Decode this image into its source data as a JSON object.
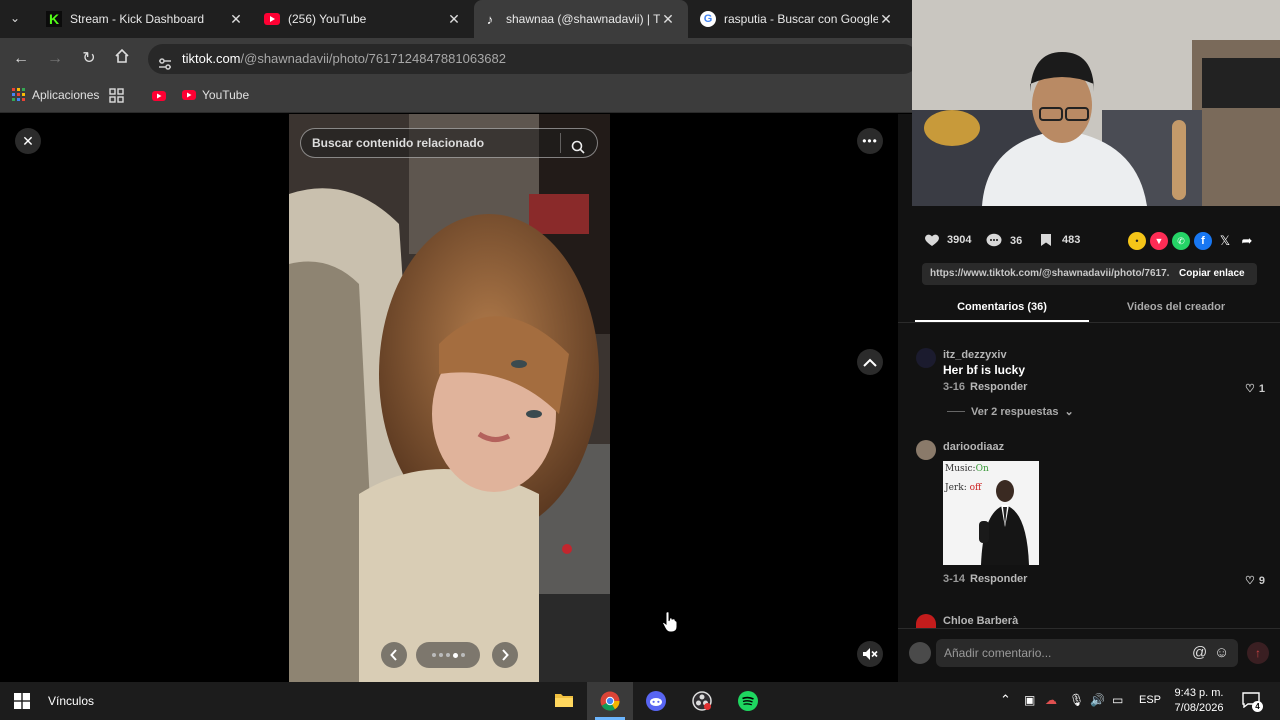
{
  "tabs": [
    {
      "title": "Stream - Kick Dashboard",
      "icon": "kick-icon",
      "color": "#53fc18"
    },
    {
      "title": "(256) YouTube",
      "icon": "youtube-icon",
      "color": "#ff0033"
    },
    {
      "title": "shawnaa (@shawnadavii) | TikT",
      "icon": "tiktok-icon",
      "color": "#ffffff"
    },
    {
      "title": "rasputia - Buscar con Google",
      "icon": "google-icon",
      "color": "#4285f4"
    }
  ],
  "address": {
    "host": "tiktok.com",
    "path": "/@shawnadavii/photo/7617124847881063682"
  },
  "bookmarks": {
    "apps": "Aplicaciones",
    "youtube": "YouTube"
  },
  "viewer": {
    "search_placeholder": "Buscar contenido relacionado",
    "slides_total": 5,
    "slide_current": 4
  },
  "actions": {
    "likes": "3904",
    "comments": "36",
    "saves": "483"
  },
  "share": {
    "url": "https://www.tiktok.com/@shawnadavii/photo/7617...",
    "copy_label": "Copiar enlace",
    "colors": [
      "#f5c518",
      "#fe2c55",
      "#25d366",
      "#1877f2"
    ]
  },
  "panel_tabs": {
    "comments": "Comentarios (36)",
    "creator_videos": "Videos del creador"
  },
  "comments": [
    {
      "user": "itz_dezzyxiv",
      "text": "Her bf is lucky",
      "date": "3-16",
      "reply": "Responder",
      "likes": "1",
      "replies": "Ver 2 respuestas"
    },
    {
      "user": "darioodiaaz",
      "date": "3-14",
      "reply": "Responder",
      "likes": "9",
      "image": {
        "line1a": "Music:",
        "line1b": "On",
        "line2a": "Jerk:",
        "line2b": "off"
      }
    },
    {
      "user": "Chloe Barberà"
    }
  ],
  "comment_input": {
    "placeholder": "Añadir comentario..."
  },
  "taskbar": {
    "links": "Vínculos",
    "lang": "ESP",
    "time": "9:43 p. m.",
    "date": "7/08/2026",
    "notifications": "4"
  }
}
